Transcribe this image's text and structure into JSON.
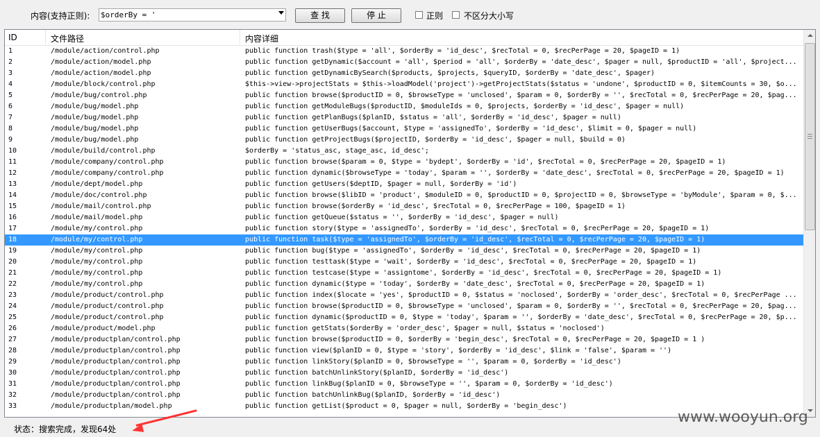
{
  "toolbar": {
    "content_label": "内容(支持正则):",
    "search_value": "$orderBy = '",
    "find_label": "查 找",
    "stop_label": "停 止",
    "regex_label": "正则",
    "ignore_case_label": "不区分大小写",
    "regex_checked": false,
    "ignore_case_checked": false
  },
  "list": {
    "columns": [
      "ID",
      "文件路径",
      "内容详细"
    ],
    "selected_id": "18",
    "rows": [
      {
        "id": "1",
        "path": "/module/action/control.php",
        "detail": "public function trash($type = 'all', $orderBy = 'id_desc', $recTotal = 0, $recPerPage = 20, $pageID = 1)"
      },
      {
        "id": "2",
        "path": "/module/action/model.php",
        "detail": "public function getDynamic($account = 'all', $period = 'all', $orderBy = 'date_desc', $pager = null, $productID = 'all', $project..."
      },
      {
        "id": "3",
        "path": "/module/action/model.php",
        "detail": "public function getDynamicBySearch($products, $projects, $queryID, $orderBy = 'date_desc', $pager)"
      },
      {
        "id": "4",
        "path": "/module/block/control.php",
        "detail": "$this->view->projectStats = $this->loadModel('project')->getProjectStats($status = 'undone', $productID = 0, $itemCounts = 30, $o..."
      },
      {
        "id": "5",
        "path": "/module/bug/control.php",
        "detail": "public function browse($productID = 0, $browseType = 'unclosed', $param = 0, $orderBy = '', $recTotal = 0, $recPerPage = 20, $pag..."
      },
      {
        "id": "6",
        "path": "/module/bug/model.php",
        "detail": "public function getModuleBugs($productID, $moduleIds = 0, $projects, $orderBy = 'id_desc', $pager = null)"
      },
      {
        "id": "7",
        "path": "/module/bug/model.php",
        "detail": "public function getPlanBugs($planID, $status = 'all', $orderBy = 'id_desc', $pager = null)"
      },
      {
        "id": "8",
        "path": "/module/bug/model.php",
        "detail": "public function getUserBugs($account, $type = 'assignedTo', $orderBy = 'id_desc', $limit = 0, $pager = null)"
      },
      {
        "id": "9",
        "path": "/module/bug/model.php",
        "detail": "public function getProjectBugs($projectID, $orderBy = 'id_desc', $pager = null, $build = 0)"
      },
      {
        "id": "10",
        "path": "/module/build/control.php",
        "detail": "$orderBy = 'status_asc, stage_asc, id_desc';"
      },
      {
        "id": "11",
        "path": "/module/company/control.php",
        "detail": "public function browse($param = 0, $type = 'bydept', $orderBy = 'id', $recTotal = 0, $recPerPage = 20, $pageID = 1)"
      },
      {
        "id": "12",
        "path": "/module/company/control.php",
        "detail": "public function dynamic($browseType = 'today', $param = '', $orderBy = 'date_desc', $recTotal = 0, $recPerPage = 20, $pageID = 1)"
      },
      {
        "id": "13",
        "path": "/module/dept/model.php",
        "detail": "public function getUsers($deptID, $pager = null, $orderBy = 'id')"
      },
      {
        "id": "14",
        "path": "/module/doc/control.php",
        "detail": "public function browse($libID = 'product', $moduleID = 0, $productID = 0, $projectID = 0, $browseType = 'byModule', $param = 0, $..."
      },
      {
        "id": "15",
        "path": "/module/mail/control.php",
        "detail": "public function browse($orderBy = 'id_desc', $recTotal = 0, $recPerPage = 100, $pageID = 1)"
      },
      {
        "id": "16",
        "path": "/module/mail/model.php",
        "detail": "public function getQueue($status = '', $orderBy = 'id_desc', $pager = null)"
      },
      {
        "id": "17",
        "path": "/module/my/control.php",
        "detail": "public function story($type = 'assignedTo', $orderBy = 'id_desc', $recTotal = 0, $recPerPage = 20, $pageID = 1)"
      },
      {
        "id": "18",
        "path": "/module/my/control.php",
        "detail": "public function task($type = 'assignedTo', $orderBy = 'id_desc', $recTotal = 0, $recPerPage = 20, $pageID = 1)"
      },
      {
        "id": "19",
        "path": "/module/my/control.php",
        "detail": "public function bug($type = 'assignedTo', $orderBy = 'id_desc', $recTotal = 0, $recPerPage = 20, $pageID = 1)"
      },
      {
        "id": "20",
        "path": "/module/my/control.php",
        "detail": "public function testtask($type = 'wait', $orderBy = 'id_desc', $recTotal = 0, $recPerPage = 20, $pageID = 1)"
      },
      {
        "id": "21",
        "path": "/module/my/control.php",
        "detail": "public function testcase($type = 'assigntome', $orderBy = 'id_desc', $recTotal = 0, $recPerPage = 20, $pageID = 1)"
      },
      {
        "id": "22",
        "path": "/module/my/control.php",
        "detail": "public function dynamic($type = 'today', $orderBy = 'date_desc', $recTotal = 0, $recPerPage = 20, $pageID = 1)"
      },
      {
        "id": "23",
        "path": "/module/product/control.php",
        "detail": "public function index($locate = 'yes', $productID = 0, $status = 'noclosed', $orderBy = 'order_desc', $recTotal = 0, $recPerPage ..."
      },
      {
        "id": "24",
        "path": "/module/product/control.php",
        "detail": "public function browse($productID = 0, $browseType = 'unclosed', $param = 0, $orderBy = '', $recTotal = 0, $recPerPage = 20, $pag..."
      },
      {
        "id": "25",
        "path": "/module/product/control.php",
        "detail": "public function dynamic($productID = 0, $type = 'today', $param = '', $orderBy = 'date_desc', $recTotal = 0, $recPerPage = 20, $p..."
      },
      {
        "id": "26",
        "path": "/module/product/model.php",
        "detail": "public function getStats($orderBy = 'order_desc', $pager = null, $status = 'noclosed')"
      },
      {
        "id": "27",
        "path": "/module/productplan/control.php",
        "detail": "public function browse($productID = 0, $orderBy = 'begin_desc', $recTotal = 0, $recPerPage = 20, $pageID = 1 )"
      },
      {
        "id": "28",
        "path": "/module/productplan/control.php",
        "detail": "public function view($planID = 0, $type = 'story', $orderBy = 'id_desc', $link = 'false', $param = '')"
      },
      {
        "id": "29",
        "path": "/module/productplan/control.php",
        "detail": "public function linkStory($planID = 0, $browseType = '', $param = 0, $orderBy = 'id_desc')"
      },
      {
        "id": "30",
        "path": "/module/productplan/control.php",
        "detail": "public function batchUnlinkStory($planID, $orderBy = 'id_desc')"
      },
      {
        "id": "31",
        "path": "/module/productplan/control.php",
        "detail": "public function linkBug($planID = 0, $browseType = '', $param = 0, $orderBy = 'id_desc')"
      },
      {
        "id": "32",
        "path": "/module/productplan/control.php",
        "detail": "public function batchUnlinkBug($planID, $orderBy = 'id_desc')"
      },
      {
        "id": "33",
        "path": "/module/productplan/model.php",
        "detail": "public function getList($product = 0, $pager = null, $orderBy = 'begin_desc')"
      }
    ]
  },
  "status": {
    "text": "状态：搜索完成，发现64处"
  },
  "watermark": "www.wooyun.org",
  "colors": {
    "selection": "#3399ff",
    "annotation_arrow": "#ff3333"
  }
}
